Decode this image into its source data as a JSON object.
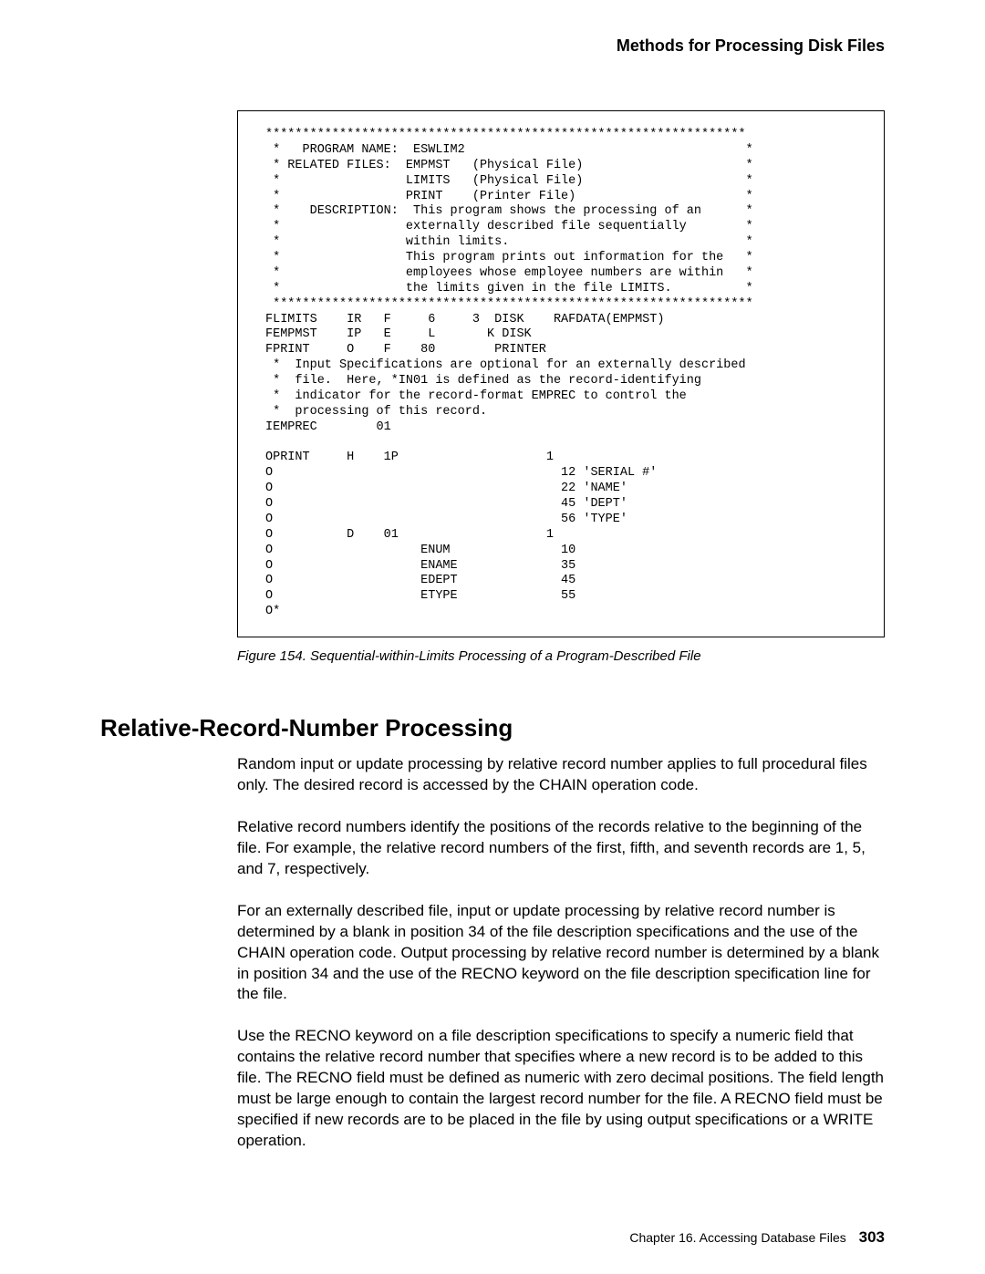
{
  "header": {
    "title": "Methods for Processing Disk Files"
  },
  "code_block": "*****************************************************************\n *   PROGRAM NAME:  ESWLIM2                                      *\n * RELATED FILES:  EMPMST   (Physical File)                      *\n *                 LIMITS   (Physical File)                      *\n *                 PRINT    (Printer File)                       *\n *    DESCRIPTION:  This program shows the processing of an      *\n *                 externally described file sequentially        *\n *                 within limits.                                *\n *                 This program prints out information for the   *\n *                 employees whose employee numbers are within   *\n *                 the limits given in the file LIMITS.          *\n *****************************************************************\nFLIMITS    IR   F     6     3  DISK    RAFDATA(EMPMST)\nFEMPMST    IP   E     L       K DISK\nFPRINT     O    F    80        PRINTER\n *  Input Specifications are optional for an externally described\n *  file.  Here, *IN01 is defined as the record-identifying\n *  indicator for the record-format EMPREC to control the\n *  processing of this record.\nIEMPREC        01\n\nOPRINT     H    1P                    1\nO                                       12 'SERIAL #'\nO                                       22 'NAME'\nO                                       45 'DEPT'\nO                                       56 'TYPE'\nO          D    01                    1\nO                    ENUM               10\nO                    ENAME              35\nO                    EDEPT              45\nO                    ETYPE              55\nO*",
  "figure": {
    "caption": "Figure  154.  Sequential-within-Limits Processing of a Program-Described File"
  },
  "section": {
    "heading": "Relative-Record-Number Processing",
    "paragraphs": [
      "Random input or update processing by relative record number applies to full procedural files only. The desired record is accessed by the CHAIN operation code.",
      "Relative record numbers identify the positions of the records relative to the beginning of the file. For example, the relative record numbers of the first, fifth, and seventh records are 1, 5, and 7, respectively.",
      "For an externally described file, input or update processing by relative record number is determined by a blank in position 34 of the file description specifications and the use of the CHAIN operation code. Output processing by relative record number is determined by a blank in position 34 and the use of the RECNO keyword on the file description specification line for the file.",
      "Use the RECNO keyword on a file description specifications to specify a numeric field that contains the relative record number that specifies where a new record is to be added to this file. The RECNO field must be defined as numeric with zero decimal positions. The field length must be large enough to contain the largest record number for the file. A RECNO field must be specified if new records are to be placed in the file by using output specifications or a WRITE operation."
    ]
  },
  "footer": {
    "chapter": "Chapter 16.  Accessing Database Files",
    "page": "303"
  }
}
